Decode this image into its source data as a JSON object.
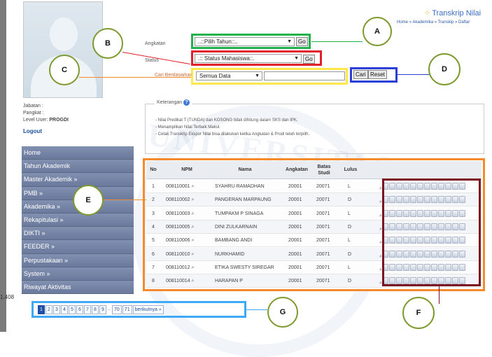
{
  "header": {
    "title": "Transkrip Nilai",
    "breadcrumb": "Home » Akademika » Transkip » Daftar"
  },
  "profile": {
    "jabatan_label": "Jabatan :",
    "pangkat_label": "Pangkat :",
    "level_label": "Level User:",
    "level_value": "PROGDI",
    "logout": "Logout"
  },
  "sidebar": {
    "items": [
      {
        "label": "Home"
      },
      {
        "label": "Tahun Akademik"
      },
      {
        "label": "Master Akademik »"
      },
      {
        "label": "PMB »"
      },
      {
        "label": "Akademika »"
      },
      {
        "label": "Rekapitulasi »"
      },
      {
        "label": "DIKTI »"
      },
      {
        "label": "FEEDER »"
      },
      {
        "label": "Perpustakaan »"
      },
      {
        "label": "System »"
      },
      {
        "label": "Riwayat Aktivitas"
      }
    ]
  },
  "filters": {
    "angkatan_label": "Angkatan",
    "angkatan_value": "..::Pilih Tahun::..",
    "status_label": "Status",
    "status_value": ".:: Status Mahasiswa::.",
    "cari_label": "Cari Berdasarkan",
    "cari_value": "Semua Data",
    "go": "Go",
    "cari_button": "Cari",
    "reset_button": "Reset"
  },
  "keterangan": {
    "legend": "Keterangan",
    "lines": [
      "- Nilai Predikat T (TUNDA) dan KOSONG tidak dihitung dalam SKS dan IPK.",
      "- Menampilkan Nilai Terbaik Makul.",
      "- Cetak Transkrip Ekspor Nilai bisa dilakukan ketika Angkatan & Prodi telah terpilih."
    ]
  },
  "table": {
    "headers": [
      "No",
      "NPM",
      "Nama",
      "Angkatan",
      "Batas Studi",
      "Lulus"
    ],
    "rows": [
      {
        "no": "1",
        "npm": "008110001",
        "nama": "SYAHRU RAMADHAN",
        "angkatan": "20001",
        "batas": "20071",
        "lulus": "L"
      },
      {
        "no": "2",
        "npm": "008110002",
        "nama": "PANGERAN MARPAUNG",
        "angkatan": "20001",
        "batas": "20071",
        "lulus": "D"
      },
      {
        "no": "3",
        "npm": "008110003",
        "nama": "TUMPAKM P SINAGA",
        "angkatan": "20001",
        "batas": "20071",
        "lulus": "L"
      },
      {
        "no": "4",
        "npm": "008110005",
        "nama": "DINI ZULKARNAIN",
        "angkatan": "20001",
        "batas": "20071",
        "lulus": "D"
      },
      {
        "no": "5",
        "npm": "008110006",
        "nama": "BAMBANG ANDI",
        "angkatan": "20001",
        "batas": "20071",
        "lulus": "L"
      },
      {
        "no": "6",
        "npm": "008110010",
        "nama": "NURKHAMID",
        "angkatan": "20001",
        "batas": "20071",
        "lulus": "D"
      },
      {
        "no": "7",
        "npm": "008110012",
        "nama": "ETIKA SWESTY SIREGAR",
        "angkatan": "20001",
        "batas": "20071",
        "lulus": "L"
      },
      {
        "no": "8",
        "npm": "008110014",
        "nama": "HARAPAN P",
        "angkatan": "20001",
        "batas": "20071",
        "lulus": "D"
      }
    ]
  },
  "total_count": "1.408",
  "pagination": {
    "pages": [
      "1",
      "2",
      "3",
      "4",
      "5",
      "6",
      "7",
      "8",
      "9",
      "..",
      "70",
      "71"
    ],
    "next": "berikutnya »"
  },
  "callouts": {
    "A": "A",
    "B": "B",
    "C": "C",
    "D": "D",
    "E": "E",
    "F": "F",
    "G": "G"
  },
  "colors": {
    "green": "#22b14c",
    "red": "#e0202a",
    "yellow": "#ffe84a",
    "blue": "#2b3fd6",
    "orange": "#f58a2c",
    "darkred": "#7a1020",
    "lightblue": "#3fa9f5"
  }
}
